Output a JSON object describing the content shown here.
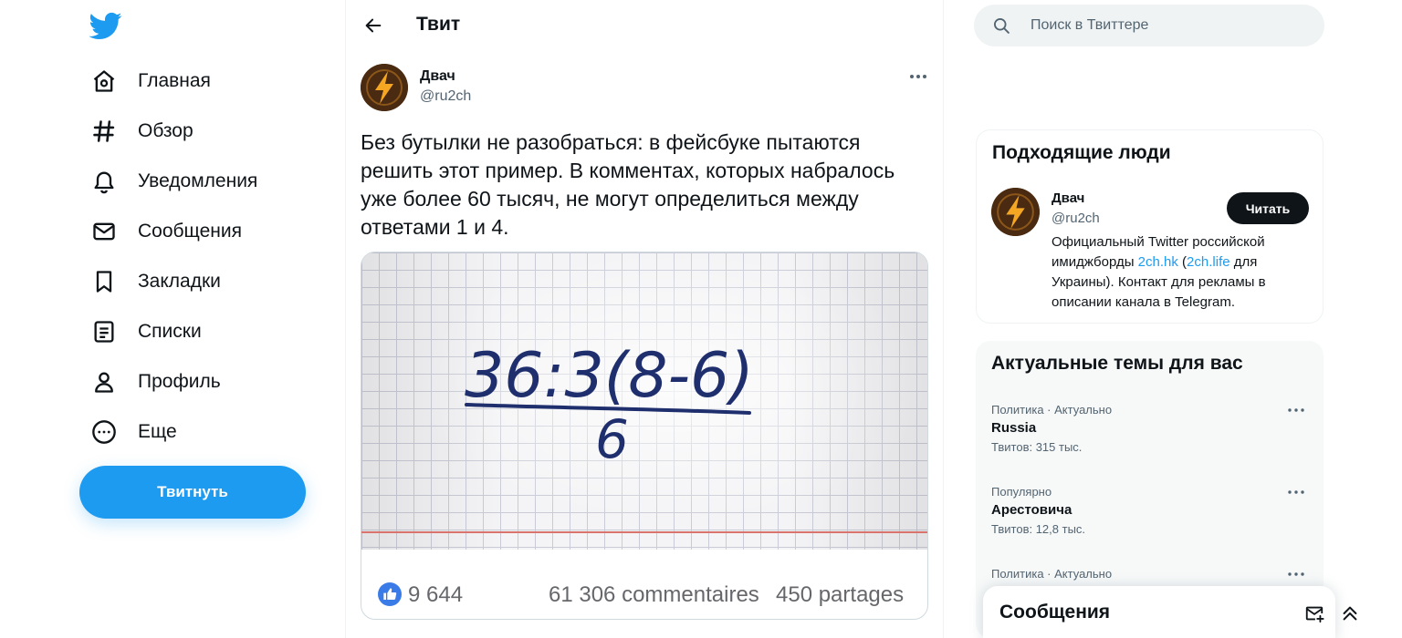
{
  "colors": {
    "accent": "#1d9bf0",
    "text": "#0f1419",
    "muted": "#536471",
    "like_blue": "#3b7be8"
  },
  "sidebar": {
    "logo_icon": "twitter-bird-icon",
    "items": [
      {
        "label": "Главная",
        "icon": "home-icon"
      },
      {
        "label": "Обзор",
        "icon": "hashtag-icon"
      },
      {
        "label": "Уведомления",
        "icon": "bell-icon"
      },
      {
        "label": "Сообщения",
        "icon": "envelope-icon"
      },
      {
        "label": "Закладки",
        "icon": "bookmark-icon"
      },
      {
        "label": "Списки",
        "icon": "list-icon"
      },
      {
        "label": "Профиль",
        "icon": "person-icon"
      },
      {
        "label": "Еще",
        "icon": "more-circle-icon"
      }
    ],
    "tweet_button": "Твитнуть"
  },
  "main": {
    "title": "Твит",
    "tweet": {
      "author_name": "Двач",
      "author_handle": "@ru2ch",
      "text": "Без бутылки не разобраться: в фейсбуке пытаются решить этот пример. В комментах, которых набралось уже более 60 тысяч, не могут определиться между ответами 1 и 4.",
      "media": {
        "numerator": "36:3(8-6)",
        "denominator": "6",
        "likes": "9 644",
        "comments": "61 306 commentaires",
        "shares": "450 partages"
      }
    }
  },
  "search": {
    "placeholder": "Поиск в Твиттере"
  },
  "who_to_follow": {
    "title": "Подходящие люди",
    "user": {
      "name": "Двач",
      "handle": "@ru2ch",
      "follow_label": "Читать",
      "bio_part1": "Официальный Twitter российской имиджборды ",
      "bio_link1": "2ch.hk",
      "bio_part2": " (",
      "bio_link2": "2ch.life",
      "bio_part3": " для Украины). Контакт для рекламы в описании канала в Telegram."
    }
  },
  "trends": {
    "title": "Актуальные темы для вас",
    "items": [
      {
        "category": "Политика · Актуально",
        "name": "Russia",
        "count": "Твитов: 315 тыс."
      },
      {
        "category": "Популярно",
        "name": "Арестовича",
        "count": "Твитов: 12,8 тыс."
      },
      {
        "category": "Политика · Актуально",
        "name": "",
        "count": ""
      }
    ]
  },
  "messages_drawer": {
    "title": "Сообщения"
  }
}
